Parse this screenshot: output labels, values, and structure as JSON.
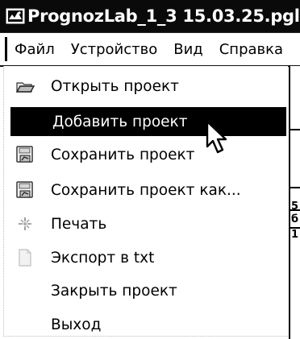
{
  "window": {
    "title": "PrognozLab_1_3 15.03.25.pgl",
    "icon": "app-window-icon"
  },
  "menubar": {
    "items": [
      "Файл",
      "Устройство",
      "Вид",
      "Справка"
    ]
  },
  "file_menu": {
    "items": [
      {
        "label": "Открыть проект",
        "icon": "open-folder-icon"
      },
      {
        "label": "Добавить проект",
        "icon": "",
        "highlighted": true
      },
      {
        "label": "Сохранить проект",
        "icon": "save-icon"
      },
      {
        "label": "Сохранить проект как...",
        "icon": "save-as-icon"
      },
      {
        "label": "Печать",
        "icon": "print-icon"
      },
      {
        "label": "Экспорт в txt",
        "icon": "export-icon"
      },
      {
        "label": "Закрыть проект",
        "icon": ""
      },
      {
        "label": "Выход",
        "icon": ""
      }
    ]
  },
  "right_panel": {
    "cell_0": "5",
    "cell_1": "б",
    "cell_2": "1"
  }
}
